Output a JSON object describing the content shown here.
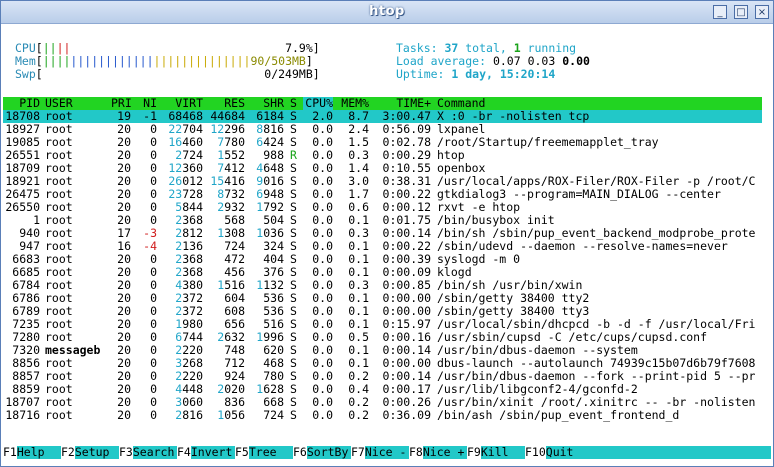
{
  "window": {
    "title": "htop",
    "buttons": [
      "_",
      "□",
      "×"
    ]
  },
  "meters": {
    "cpu": {
      "label": "CPU",
      "value": "7.9%"
    },
    "mem": {
      "label": "Mem",
      "value": "90/503MB"
    },
    "swp": {
      "label": "Swp",
      "value": "0/249MB"
    }
  },
  "summary": {
    "tasks_label": "Tasks: ",
    "tasks_total": "37",
    "tasks_mid": " total, ",
    "tasks_running": "1",
    "tasks_tail": " running",
    "load_label": "Load average: ",
    "load1": "0.07",
    "load5": "0.03",
    "load15": "0.00",
    "uptime_label": "Uptime: ",
    "uptime_value": "1 day, 15:20:14"
  },
  "columns": [
    "PID",
    "USER",
    "PRI",
    "NI",
    "VIRT",
    "RES",
    "SHR",
    "S",
    "CPU%",
    "MEM%",
    "TIME+",
    "Command"
  ],
  "processes": [
    {
      "pid": "18708",
      "user": "root",
      "pri": "19",
      "ni": "-1",
      "virt": "68468",
      "res": "44684",
      "shr": "6184",
      "s": "S",
      "cpu": "2.0",
      "mem": "8.7",
      "time": "3:00.47",
      "cmd": "X :0 -br -nolisten tcp"
    },
    {
      "pid": "18927",
      "user": "root",
      "pri": "20",
      "ni": "0",
      "virt": "22704",
      "res": "12296",
      "shr": "8816",
      "s": "S",
      "cpu": "0.0",
      "mem": "2.4",
      "time": "0:56.09",
      "cmd": "lxpanel"
    },
    {
      "pid": "19085",
      "user": "root",
      "pri": "20",
      "ni": "0",
      "virt": "16460",
      "res": "7780",
      "shr": "6424",
      "s": "S",
      "cpu": "0.0",
      "mem": "1.5",
      "time": "0:02.78",
      "cmd": "/root/Startup/freememapplet_tray"
    },
    {
      "pid": "26551",
      "user": "root",
      "pri": "20",
      "ni": "0",
      "virt": "2724",
      "res": "1552",
      "shr": "988",
      "s": "R",
      "cpu": "0.0",
      "mem": "0.3",
      "time": "0:00.29",
      "cmd": "htop"
    },
    {
      "pid": "18709",
      "user": "root",
      "pri": "20",
      "ni": "0",
      "virt": "12360",
      "res": "7412",
      "shr": "4648",
      "s": "S",
      "cpu": "0.0",
      "mem": "1.4",
      "time": "0:10.55",
      "cmd": "openbox"
    },
    {
      "pid": "18921",
      "user": "root",
      "pri": "20",
      "ni": "0",
      "virt": "26012",
      "res": "15416",
      "shr": "9016",
      "s": "S",
      "cpu": "0.0",
      "mem": "3.0",
      "time": "0:38.31",
      "cmd": "/usr/local/apps/ROX-Filer/ROX-Filer -p /root/C"
    },
    {
      "pid": "26475",
      "user": "root",
      "pri": "20",
      "ni": "0",
      "virt": "23728",
      "res": "8732",
      "shr": "6948",
      "s": "S",
      "cpu": "0.0",
      "mem": "1.7",
      "time": "0:00.22",
      "cmd": "gtkdialog3 --program=MAIN_DIALOG --center"
    },
    {
      "pid": "26550",
      "user": "root",
      "pri": "20",
      "ni": "0",
      "virt": "5844",
      "res": "2932",
      "shr": "1792",
      "s": "S",
      "cpu": "0.0",
      "mem": "0.6",
      "time": "0:00.12",
      "cmd": "rxvt -e htop"
    },
    {
      "pid": "1",
      "user": "root",
      "pri": "20",
      "ni": "0",
      "virt": "2368",
      "res": "568",
      "shr": "504",
      "s": "S",
      "cpu": "0.0",
      "mem": "0.1",
      "time": "0:01.75",
      "cmd": "/bin/busybox init"
    },
    {
      "pid": "940",
      "user": "root",
      "pri": "17",
      "ni": "-3",
      "virt": "2812",
      "res": "1308",
      "shr": "1036",
      "s": "S",
      "cpu": "0.0",
      "mem": "0.3",
      "time": "0:00.14",
      "cmd": "/bin/sh /sbin/pup_event_backend_modprobe_prote"
    },
    {
      "pid": "947",
      "user": "root",
      "pri": "16",
      "ni": "-4",
      "virt": "2136",
      "res": "724",
      "shr": "324",
      "s": "S",
      "cpu": "0.0",
      "mem": "0.1",
      "time": "0:00.22",
      "cmd": "/sbin/udevd --daemon --resolve-names=never"
    },
    {
      "pid": "6683",
      "user": "root",
      "pri": "20",
      "ni": "0",
      "virt": "2368",
      "res": "472",
      "shr": "404",
      "s": "S",
      "cpu": "0.0",
      "mem": "0.1",
      "time": "0:00.39",
      "cmd": "syslogd -m 0"
    },
    {
      "pid": "6685",
      "user": "root",
      "pri": "20",
      "ni": "0",
      "virt": "2368",
      "res": "456",
      "shr": "376",
      "s": "S",
      "cpu": "0.0",
      "mem": "0.1",
      "time": "0:00.09",
      "cmd": "klogd"
    },
    {
      "pid": "6784",
      "user": "root",
      "pri": "20",
      "ni": "0",
      "virt": "4380",
      "res": "1516",
      "shr": "1132",
      "s": "S",
      "cpu": "0.0",
      "mem": "0.3",
      "time": "0:00.85",
      "cmd": "/bin/sh /usr/bin/xwin"
    },
    {
      "pid": "6786",
      "user": "root",
      "pri": "20",
      "ni": "0",
      "virt": "2372",
      "res": "604",
      "shr": "536",
      "s": "S",
      "cpu": "0.0",
      "mem": "0.1",
      "time": "0:00.00",
      "cmd": "/sbin/getty 38400 tty2"
    },
    {
      "pid": "6789",
      "user": "root",
      "pri": "20",
      "ni": "0",
      "virt": "2372",
      "res": "608",
      "shr": "536",
      "s": "S",
      "cpu": "0.0",
      "mem": "0.1",
      "time": "0:00.00",
      "cmd": "/sbin/getty 38400 tty3"
    },
    {
      "pid": "7235",
      "user": "root",
      "pri": "20",
      "ni": "0",
      "virt": "1980",
      "res": "656",
      "shr": "516",
      "s": "S",
      "cpu": "0.0",
      "mem": "0.1",
      "time": "0:15.97",
      "cmd": "/usr/local/sbin/dhcpcd -b -d -f /usr/local/Fri"
    },
    {
      "pid": "7280",
      "user": "root",
      "pri": "20",
      "ni": "0",
      "virt": "6744",
      "res": "2632",
      "shr": "1996",
      "s": "S",
      "cpu": "0.0",
      "mem": "0.5",
      "time": "0:00.16",
      "cmd": "/usr/sbin/cupsd -C /etc/cups/cupsd.conf"
    },
    {
      "pid": "7320",
      "user": "messageb",
      "pri": "20",
      "ni": "0",
      "virt": "2220",
      "res": "748",
      "shr": "620",
      "s": "S",
      "cpu": "0.0",
      "mem": "0.1",
      "time": "0:00.14",
      "cmd": "/usr/bin/dbus-daemon --system"
    },
    {
      "pid": "8856",
      "user": "root",
      "pri": "20",
      "ni": "0",
      "virt": "3268",
      "res": "712",
      "shr": "468",
      "s": "S",
      "cpu": "0.0",
      "mem": "0.1",
      "time": "0:00.00",
      "cmd": "dbus-launch --autolaunch 74939c15b07d6b79f7608"
    },
    {
      "pid": "8857",
      "user": "root",
      "pri": "20",
      "ni": "0",
      "virt": "2220",
      "res": "924",
      "shr": "780",
      "s": "S",
      "cpu": "0.0",
      "mem": "0.2",
      "time": "0:00.14",
      "cmd": "/usr/bin/dbus-daemon --fork --print-pid 5 --pr"
    },
    {
      "pid": "8859",
      "user": "root",
      "pri": "20",
      "ni": "0",
      "virt": "4448",
      "res": "2020",
      "shr": "1628",
      "s": "S",
      "cpu": "0.0",
      "mem": "0.4",
      "time": "0:00.17",
      "cmd": "/usr/lib/libgconf2-4/gconfd-2"
    },
    {
      "pid": "18707",
      "user": "root",
      "pri": "20",
      "ni": "0",
      "virt": "3060",
      "res": "836",
      "shr": "668",
      "s": "S",
      "cpu": "0.0",
      "mem": "0.2",
      "time": "0:00.26",
      "cmd": "/usr/bin/xinit /root/.xinitrc -- -br -nolisten"
    },
    {
      "pid": "18716",
      "user": "root",
      "pri": "20",
      "ni": "0",
      "virt": "2816",
      "res": "1056",
      "shr": "724",
      "s": "S",
      "cpu": "0.0",
      "mem": "0.2",
      "time": "0:36.09",
      "cmd": "/bin/ash /sbin/pup_event_frontend_d"
    }
  ],
  "footer": [
    {
      "key": "F1",
      "label": "Help  "
    },
    {
      "key": "F2",
      "label": "Setup "
    },
    {
      "key": "F3",
      "label": "Search"
    },
    {
      "key": "F4",
      "label": "Invert"
    },
    {
      "key": "F5",
      "label": "Tree  "
    },
    {
      "key": "F6",
      "label": "SortBy"
    },
    {
      "key": "F7",
      "label": "Nice -"
    },
    {
      "key": "F8",
      "label": "Nice +"
    },
    {
      "key": "F9",
      "label": "Kill  "
    },
    {
      "key": "F10",
      "label": "Quit"
    }
  ],
  "colors": {
    "header_green": "#22d422",
    "selection_cyan": "#22c8c8",
    "label_cyan": "#1fa5c8",
    "negative_red": "#d01b1b"
  }
}
